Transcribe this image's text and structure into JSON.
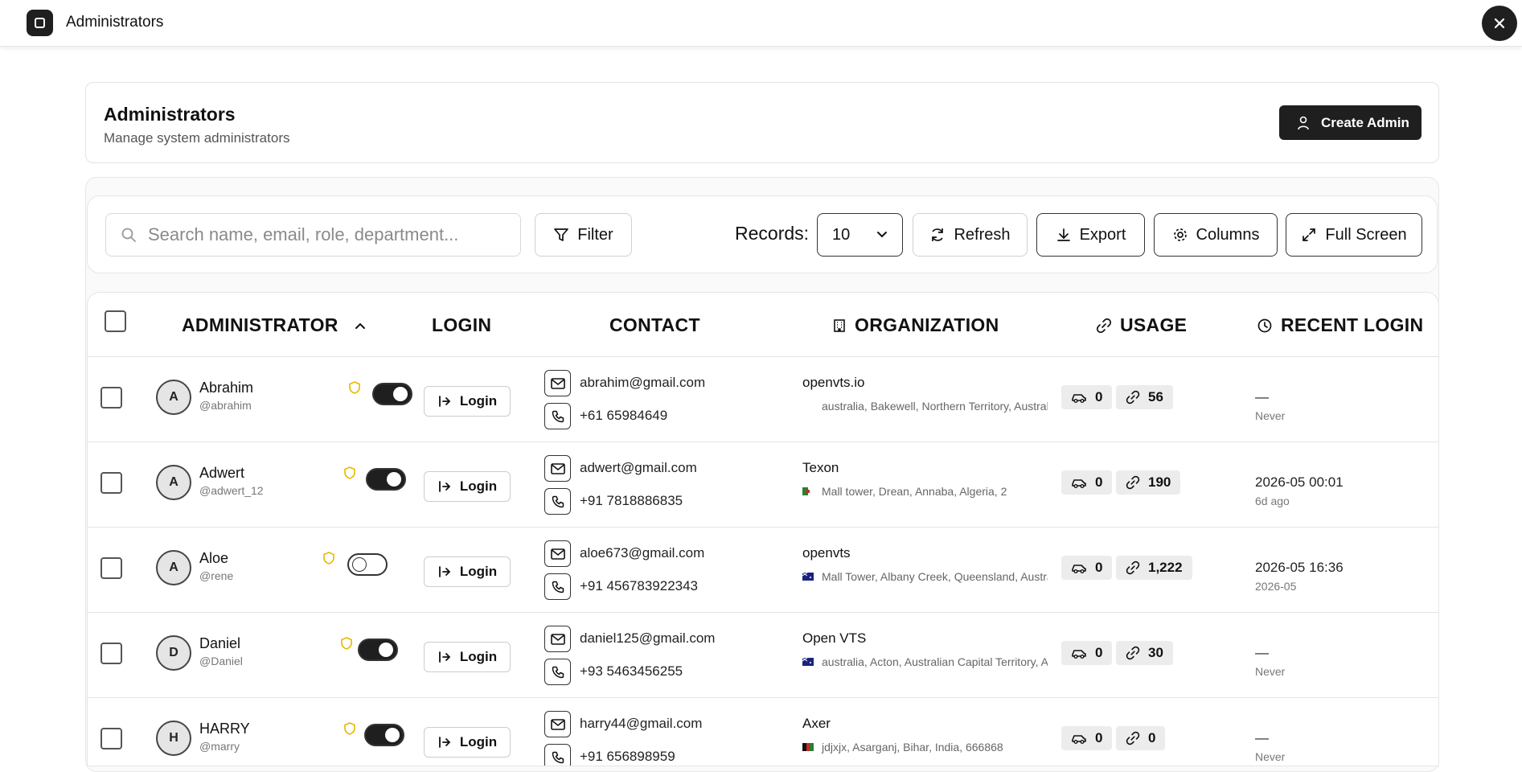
{
  "window": {
    "title": "Administrators"
  },
  "header": {
    "title": "Administrators",
    "subtitle": "Manage system administrators",
    "create_label": "Create Admin"
  },
  "toolbar": {
    "search_placeholder": "Search name, email, role, department...",
    "filter_label": "Filter",
    "records_label": "Records:",
    "records_value": "10",
    "refresh_label": "Refresh",
    "export_label": "Export",
    "columns_label": "Columns",
    "fullscreen_label": "Full Screen"
  },
  "table": {
    "headers": {
      "administrator": "ADMINISTRATOR",
      "login": "LOGIN",
      "contact": "CONTACT",
      "organization": "ORGANIZATION",
      "usage": "USAGE",
      "recent_login": "RECENT LOGIN"
    },
    "login_label": "Login",
    "rows": [
      {
        "initial": "A",
        "name": "Abrahim",
        "handle": "@abrahim",
        "active": true,
        "email": "abrahim@gmail.com",
        "phone": "+61 65984649",
        "org": "openvts.io",
        "address": "australia, Bakewell, Northern Territory, Australia",
        "vehicles": "0",
        "links": "56",
        "recent": "—",
        "recent_sub": "Never",
        "flag": "none"
      },
      {
        "initial": "A",
        "name": "Adwert",
        "handle": "@adwert_12",
        "active": true,
        "email": "adwert@gmail.com",
        "phone": "+91 7818886835",
        "org": "Texon",
        "address": "Mall tower, Drean, Annaba, Algeria, 2",
        "vehicles": "0",
        "links": "190",
        "recent": "2026-05 00:01",
        "recent_sub": "6d ago",
        "flag": "algeria"
      },
      {
        "initial": "A",
        "name": "Aloe",
        "handle": "@rene",
        "active": false,
        "email": "aloe673@gmail.com",
        "phone": "+91 456783922343",
        "org": "openvts",
        "address": "Mall Tower, Albany Creek, Queensland, Australia",
        "vehicles": "0",
        "links": "1,222",
        "recent": "2026-05 16:36",
        "recent_sub": "2026-05",
        "flag": "australia"
      },
      {
        "initial": "D",
        "name": "Daniel",
        "handle": "@Daniel",
        "active": true,
        "email": "daniel125@gmail.com",
        "phone": "+93 5463456255",
        "org": "Open VTS",
        "address": "australia, Acton, Australian Capital Territory, Australia",
        "vehicles": "0",
        "links": "30",
        "recent": "—",
        "recent_sub": "Never",
        "flag": "australia"
      },
      {
        "initial": "H",
        "name": "HARRY",
        "handle": "@marry",
        "active": true,
        "email": "harry44@gmail.com",
        "phone": "+91 656898959",
        "org": "Axer",
        "address": "jdjxjx, Asarganj, Bihar, India, 666868",
        "vehicles": "0",
        "links": "0",
        "recent": "—",
        "recent_sub": "Never",
        "flag": "afghanistan"
      }
    ]
  },
  "colors": {
    "dark": "#1f1f1f",
    "shield": "#e6b800",
    "chip": "#ececec"
  }
}
